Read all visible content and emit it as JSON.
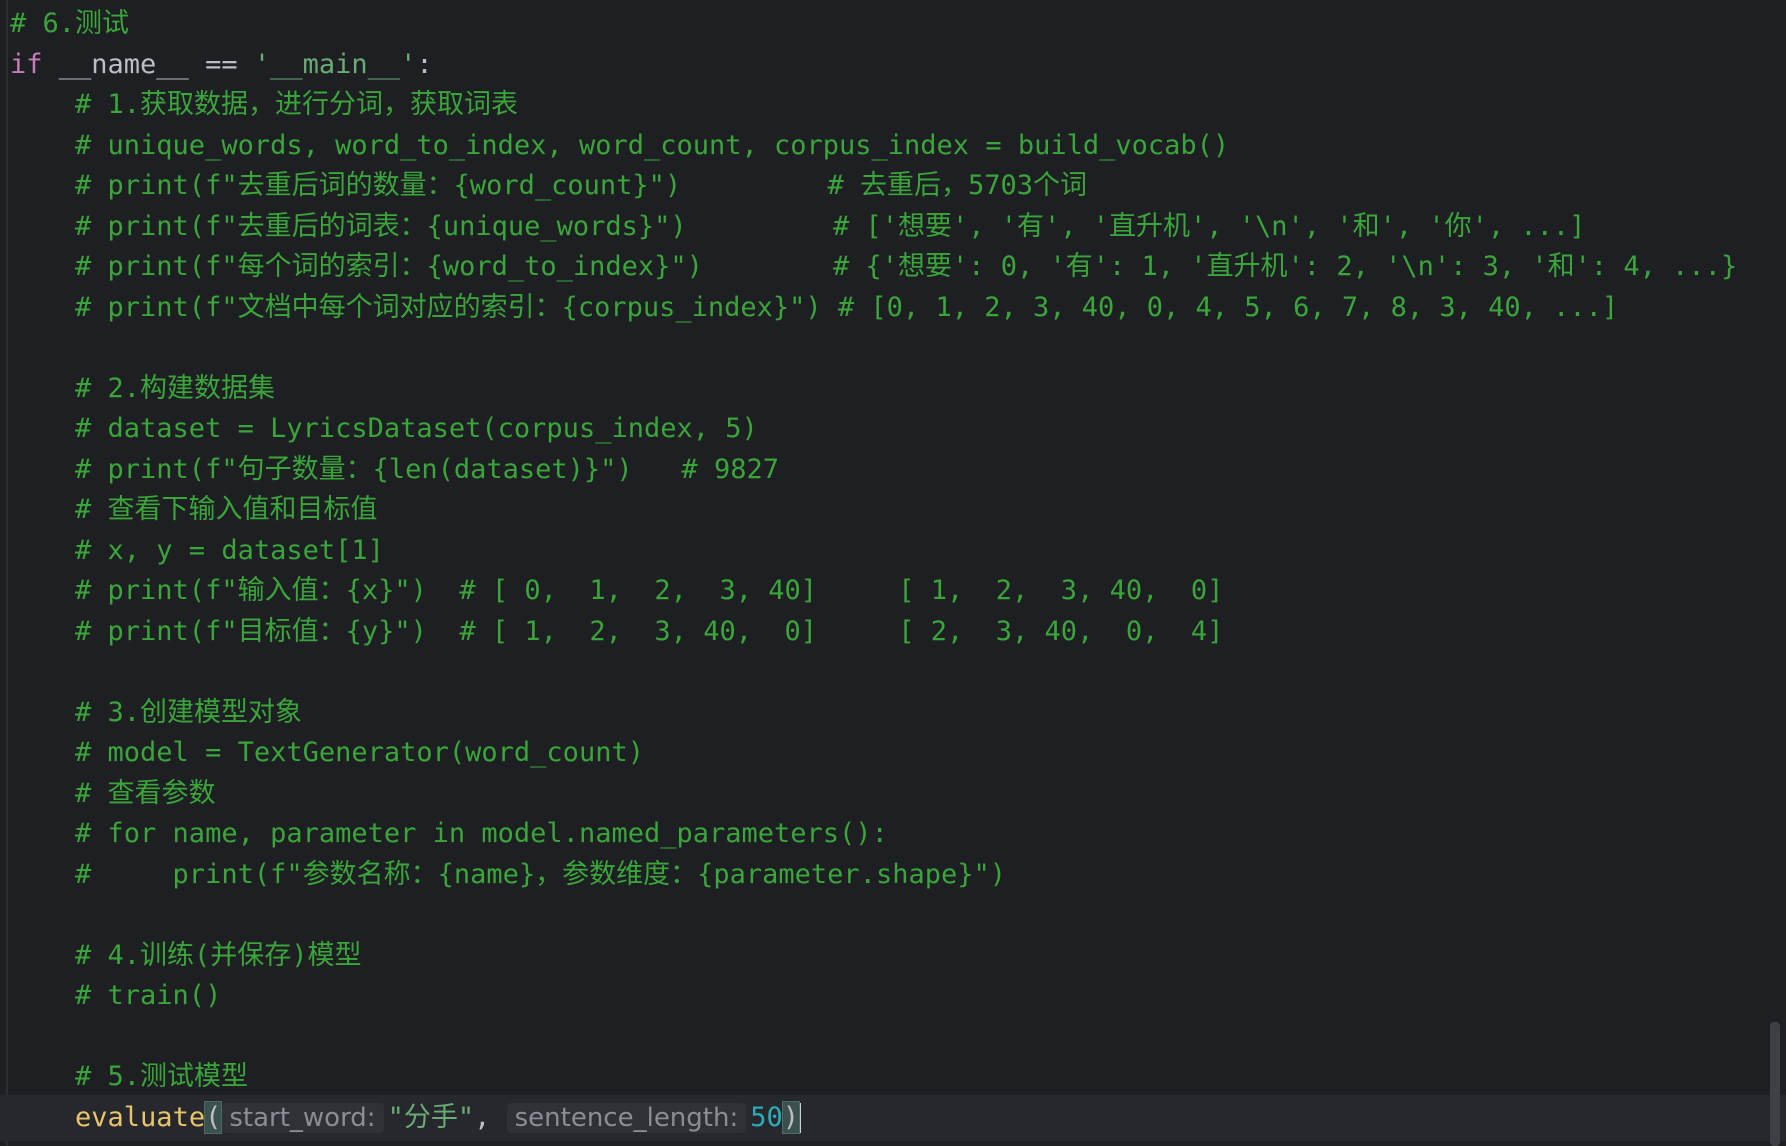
{
  "editor": {
    "lines": [
      {
        "text": "# 6.测试",
        "kind": "comment"
      },
      {
        "text": "",
        "kind": "main-guard"
      },
      {
        "text": "    # 1.获取数据，进行分词，获取词表",
        "kind": "comment"
      },
      {
        "text": "    # unique_words, word_to_index, word_count, corpus_index = build_vocab()",
        "kind": "comment"
      },
      {
        "text": "    # print(f\"去重后词的数量：{word_count}\")         # 去重后，5703个词",
        "kind": "comment"
      },
      {
        "text": "    # print(f\"去重后的词表：{unique_words}\")         # ['想要', '有', '直升机', '\\n', '和', '你', ...]",
        "kind": "comment"
      },
      {
        "text": "    # print(f\"每个词的索引：{word_to_index}\")        # {'想要': 0, '有': 1, '直升机': 2, '\\n': 3, '和': 4, ...}",
        "kind": "comment"
      },
      {
        "text": "    # print(f\"文档中每个词对应的索引：{corpus_index}\") # [0, 1, 2, 3, 40, 0, 4, 5, 6, 7, 8, 3, 40, ...]",
        "kind": "comment"
      },
      {
        "text": "",
        "kind": "blank"
      },
      {
        "text": "    # 2.构建数据集",
        "kind": "comment"
      },
      {
        "text": "    # dataset = LyricsDataset(corpus_index, 5)",
        "kind": "comment"
      },
      {
        "text": "    # print(f\"句子数量：{len(dataset)}\")   # 9827",
        "kind": "comment"
      },
      {
        "text": "    # 查看下输入值和目标值",
        "kind": "comment"
      },
      {
        "text": "    # x, y = dataset[1]",
        "kind": "comment"
      },
      {
        "text": "    # print(f\"输入值：{x}\")  # [ 0,  1,  2,  3, 40]     [ 1,  2,  3, 40,  0]",
        "kind": "comment"
      },
      {
        "text": "    # print(f\"目标值：{y}\")  # [ 1,  2,  3, 40,  0]     [ 2,  3, 40,  0,  4]",
        "kind": "comment"
      },
      {
        "text": "",
        "kind": "blank"
      },
      {
        "text": "    # 3.创建模型对象",
        "kind": "comment"
      },
      {
        "text": "    # model = TextGenerator(word_count)",
        "kind": "comment"
      },
      {
        "text": "    # 查看参数",
        "kind": "comment"
      },
      {
        "text": "    # for name, parameter in model.named_parameters():",
        "kind": "comment"
      },
      {
        "text": "    #     print(f\"参数名称：{name}，参数维度：{parameter.shape}\")",
        "kind": "comment"
      },
      {
        "text": "",
        "kind": "blank"
      },
      {
        "text": "    # 4.训练(并保存)模型",
        "kind": "comment"
      },
      {
        "text": "    # train()",
        "kind": "comment"
      },
      {
        "text": "",
        "kind": "blank"
      },
      {
        "text": "    # 5.测试模型",
        "kind": "comment"
      },
      {
        "text": "",
        "kind": "call"
      }
    ],
    "main_guard": {
      "keyword": "if",
      "name": " __name__ == ",
      "string": "'__main__'",
      "colon": ":"
    },
    "call": {
      "indent": "    ",
      "function": "evaluate",
      "open_paren": "(",
      "hint_start_word": "start_word:",
      "arg_start_word": "\"分手\"",
      "comma": ", ",
      "hint_sentence_length": "sentence_length:",
      "arg_sentence_length": "50",
      "close_paren": ")"
    }
  },
  "colors": {
    "background": "#1e1f22",
    "comment": "#3aa53a",
    "keyword": "#c77dbb",
    "string": "#6aab73",
    "number": "#2aacb8",
    "function": "#e8c46a"
  }
}
